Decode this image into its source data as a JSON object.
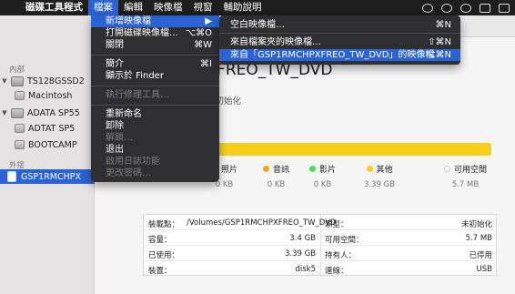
{
  "menubar": {
    "apple": "",
    "app": "磁碟工具程式",
    "items": [
      "檔案",
      "編輯",
      "映像檔",
      "視窗",
      "輔助說明"
    ]
  },
  "sidebar": {
    "section_internal": "內部",
    "section_external": "外接",
    "rows": [
      {
        "label": "TS128GSSD2",
        "kind": "disk"
      },
      {
        "label": "Macintosh",
        "kind": "volume"
      },
      {
        "label": "ADATA SP55",
        "kind": "disk"
      },
      {
        "label": "ADTAT SP5",
        "kind": "volume"
      },
      {
        "label": "BOOTCAMP",
        "kind": "volume"
      },
      {
        "label": "GSP1RMCHPX",
        "kind": "external"
      }
    ]
  },
  "disk": {
    "title": "GSP1RMCHPXFREO_TW_DVD",
    "subtitle": "未初始化",
    "usage_color": "#f6cf19"
  },
  "legend": [
    {
      "label": "照片",
      "value": "0 KB",
      "color": "#e94b3c"
    },
    {
      "label": "音訊",
      "value": "0 KB",
      "color": "#f5a623"
    },
    {
      "label": "影片",
      "value": "0 KB",
      "color": "#4cd964"
    },
    {
      "label": "其他",
      "value": "3.39 GB",
      "color": "#f6cf19"
    },
    {
      "label": "可用空間",
      "value": "5.7 MB",
      "color": "#ffffff"
    }
  ],
  "info": {
    "rows": [
      {
        "l_label": "裝載點：",
        "l_value": "/Volumes/GSP1RMCHPXFREO_TW_DVD",
        "r_label": "類型：",
        "r_value": "未初始化"
      },
      {
        "l_label": "容量：",
        "l_value": "3.4 GB",
        "r_label": "可用空間：",
        "r_value": "5.7 MB"
      },
      {
        "l_label": "已使用：",
        "l_value": "3.39 GB",
        "r_label": "持有人：",
        "r_value": "已停用"
      },
      {
        "l_label": "裝置：",
        "l_value": "disk5",
        "r_label": "連線：",
        "r_value": "USB"
      }
    ]
  },
  "file_menu": {
    "items": [
      {
        "label": "新增映像檔",
        "shortcut": "▶",
        "state": "highlight"
      },
      {
        "label": "打開磁碟映像檔…",
        "shortcut": "⌥⌘O",
        "state": "normal"
      },
      {
        "label": "關閉",
        "shortcut": "⌘W",
        "state": "normal"
      },
      {
        "label": "簡介",
        "shortcut": "⌘I",
        "state": "normal"
      },
      {
        "label": "顯示於 Finder",
        "shortcut": "",
        "state": "normal"
      },
      {
        "label": "執行修理工具…",
        "shortcut": "",
        "state": "disabled"
      },
      {
        "label": "重新命名",
        "shortcut": "",
        "state": "normal"
      },
      {
        "label": "卸除",
        "shortcut": "",
        "state": "normal"
      },
      {
        "label": "解鎖…",
        "shortcut": "",
        "state": "disabled"
      },
      {
        "label": "退出",
        "shortcut": "",
        "state": "normal"
      },
      {
        "label": "啟用日誌功能",
        "shortcut": "",
        "state": "disabled"
      },
      {
        "label": "更改密碼…",
        "shortcut": "",
        "state": "disabled"
      }
    ]
  },
  "submenu": {
    "items": [
      {
        "label": "空白映像檔…",
        "shortcut": "⌘N",
        "state": "normal"
      },
      {
        "label": "來自檔案夾的映像檔…",
        "shortcut": "⇧⌘N",
        "state": "normal"
      },
      {
        "label": "來自「GSP1RMCHPXFREO_TW_DVD」的映像檔",
        "shortcut": "⌥⌘N",
        "state": "highlight"
      }
    ]
  }
}
